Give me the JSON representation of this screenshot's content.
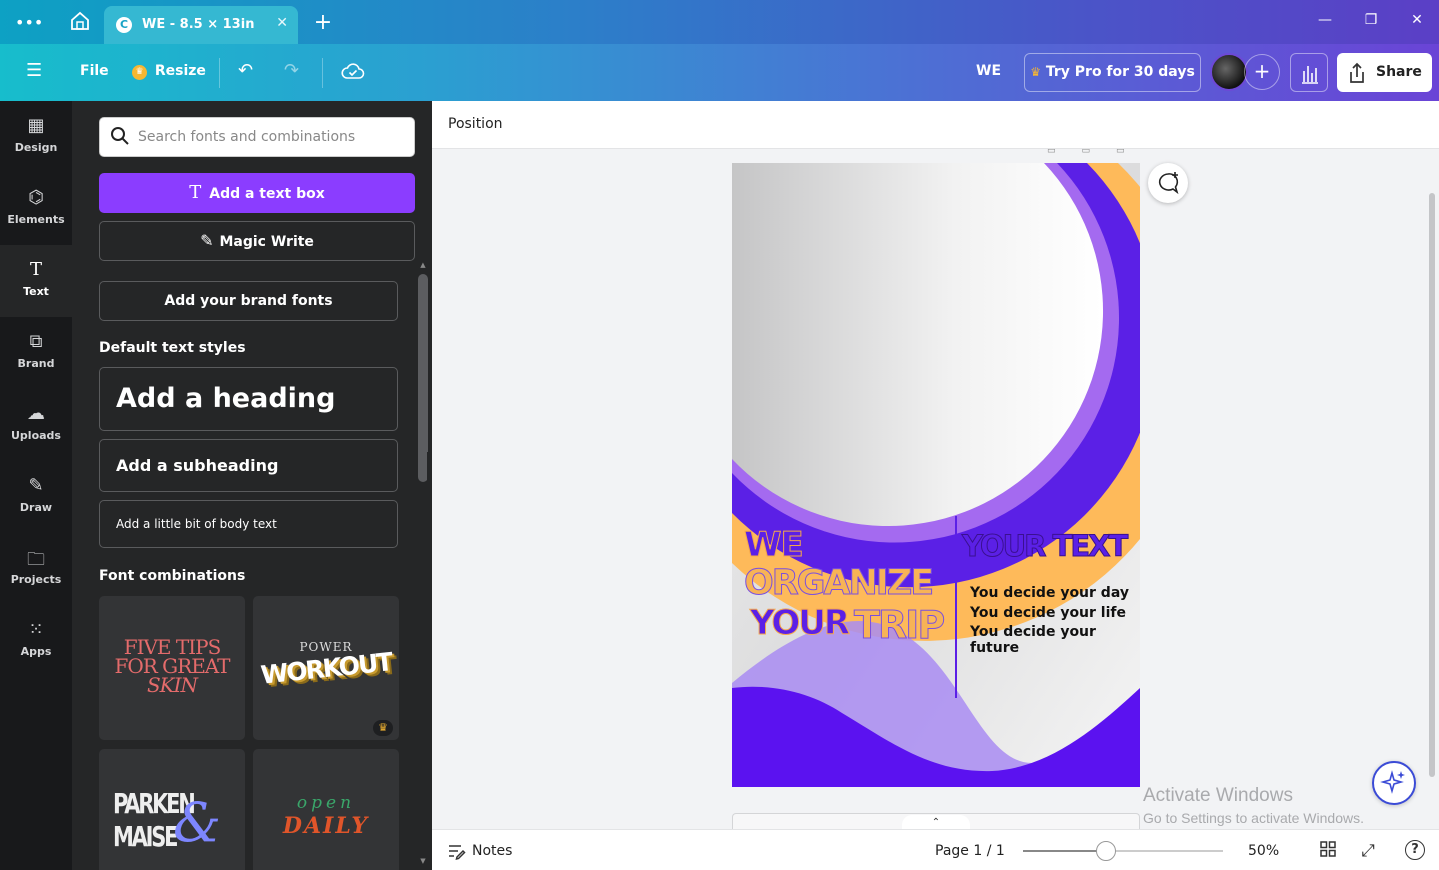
{
  "browser": {
    "tab_title": "WE - 8.5 × 13in",
    "favicon_letter": "C",
    "new_tab": "+"
  },
  "toolbar": {
    "file": "File",
    "resize": "Resize",
    "design_name": "WE",
    "try_pro": "Try Pro for 30 days",
    "share": "Share"
  },
  "rail": {
    "items": [
      {
        "label": "Design",
        "icon": "design-icon"
      },
      {
        "label": "Elements",
        "icon": "elements-icon"
      },
      {
        "label": "Text",
        "icon": "text-icon"
      },
      {
        "label": "Brand",
        "icon": "brand-icon"
      },
      {
        "label": "Uploads",
        "icon": "uploads-icon"
      },
      {
        "label": "Draw",
        "icon": "draw-icon"
      },
      {
        "label": "Projects",
        "icon": "projects-icon"
      },
      {
        "label": "Apps",
        "icon": "apps-icon"
      }
    ],
    "active": "Text"
  },
  "panel": {
    "search_placeholder": "Search fonts and combinations",
    "add_text_box": "Add a text box",
    "magic_write": "Magic Write",
    "brand_fonts": "Add your brand fonts",
    "default_styles_title": "Default text styles",
    "heading": "Add a heading",
    "subheading": "Add a subheading",
    "body": "Add a little bit of body text",
    "combos_title": "Font combinations",
    "combos": [
      {
        "lines": [
          "FIVE TIPS",
          "FOR GREAT",
          "SKIN"
        ]
      },
      {
        "small": "POWER",
        "big": "WORKOUT",
        "pro": true
      },
      {
        "lines": [
          "PARKEN",
          "MAISE"
        ],
        "script": "&"
      },
      {
        "small": "open",
        "big": "DAILY"
      }
    ]
  },
  "editor": {
    "position_label": "Position",
    "design": {
      "we": "WE",
      "organize": "ORGANIZE",
      "your": "YOUR",
      "trip": "TRIP",
      "your_text": "YOUR TEXT",
      "lines": [
        "You decide your day",
        "You decide your life",
        "You decide your future"
      ]
    },
    "watermark_title": "Activate Windows",
    "watermark_sub": "Go to Settings to activate Windows."
  },
  "footer": {
    "notes": "Notes",
    "page": "Page 1 / 1",
    "zoom": "50%",
    "zoom_fraction": 0.5
  },
  "colors": {
    "accent": "#8b3dff",
    "design_purple": "#5b20e6",
    "design_orange": "#f7b356"
  }
}
